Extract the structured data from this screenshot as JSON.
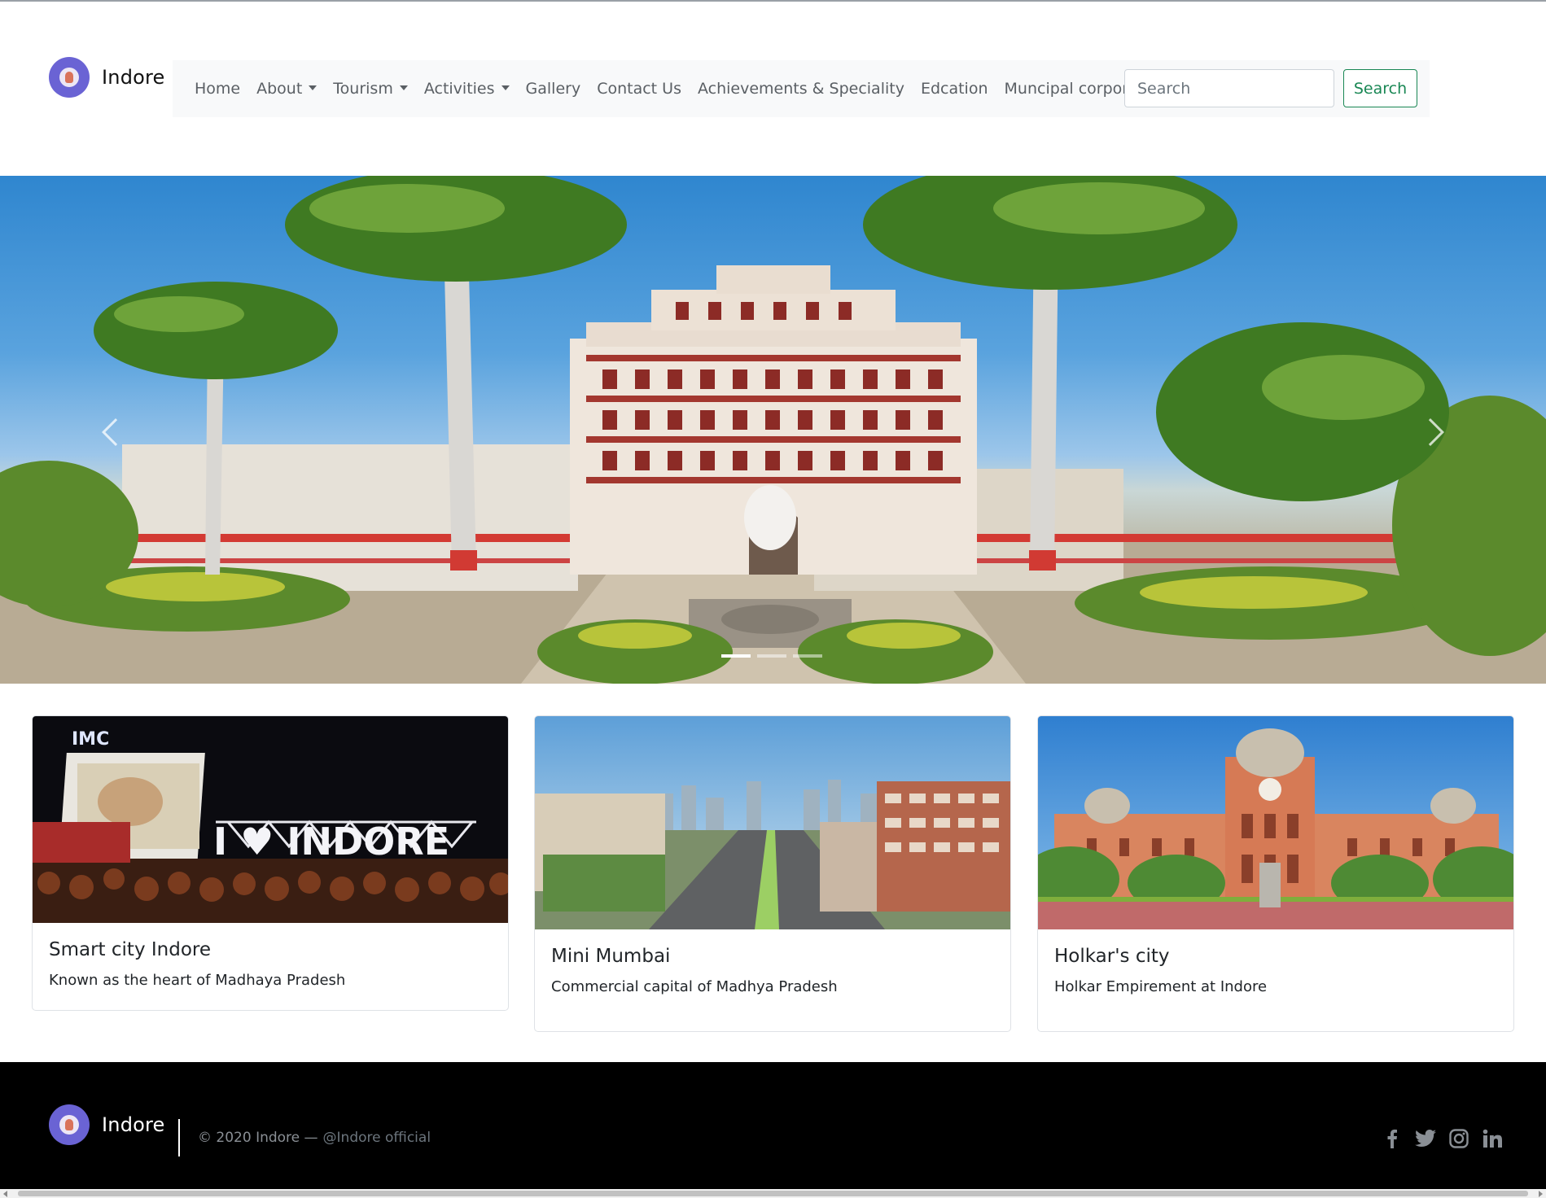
{
  "brand": {
    "name": "Indore",
    "logo_icon": "indore-emblem-icon"
  },
  "nav": {
    "items": [
      {
        "label": "Home",
        "dropdown": false
      },
      {
        "label": "About",
        "dropdown": true
      },
      {
        "label": "Tourism",
        "dropdown": true
      },
      {
        "label": "Activities",
        "dropdown": true
      },
      {
        "label": "Gallery",
        "dropdown": false
      },
      {
        "label": "Contact Us",
        "dropdown": false
      },
      {
        "label": "Achievements & Speciality",
        "dropdown": false
      },
      {
        "label": "Edcation",
        "dropdown": false
      },
      {
        "label": "Muncipal corporation",
        "dropdown": false
      }
    ],
    "search_placeholder": "Search",
    "search_button": "Search"
  },
  "carousel": {
    "slide_count": 3,
    "active_slide": 1,
    "prev_icon": "chevron-left-icon",
    "next_icon": "chevron-right-icon"
  },
  "cards": [
    {
      "title": "Smart city Indore",
      "text": "Known as the heart of Madhaya Pradesh",
      "image_text": "IMC",
      "image_caption": "I ♥ INDORE"
    },
    {
      "title": "Mini Mumbai",
      "text": "Commercial capital of Madhya Pradesh"
    },
    {
      "title": "Holkar's city",
      "text": "Holkar Empirement at Indore"
    }
  ],
  "footer": {
    "brand": "Indore",
    "copyright": "© 2020 Indore —",
    "handle": "@Indore official",
    "socials": [
      "facebook-icon",
      "twitter-icon",
      "instagram-icon",
      "linkedin-icon"
    ]
  },
  "colors": {
    "accent_green": "#198754",
    "navbar_bg": "#f8f9fa",
    "footer_bg": "#000000",
    "logo_purple": "#6a63d4"
  }
}
